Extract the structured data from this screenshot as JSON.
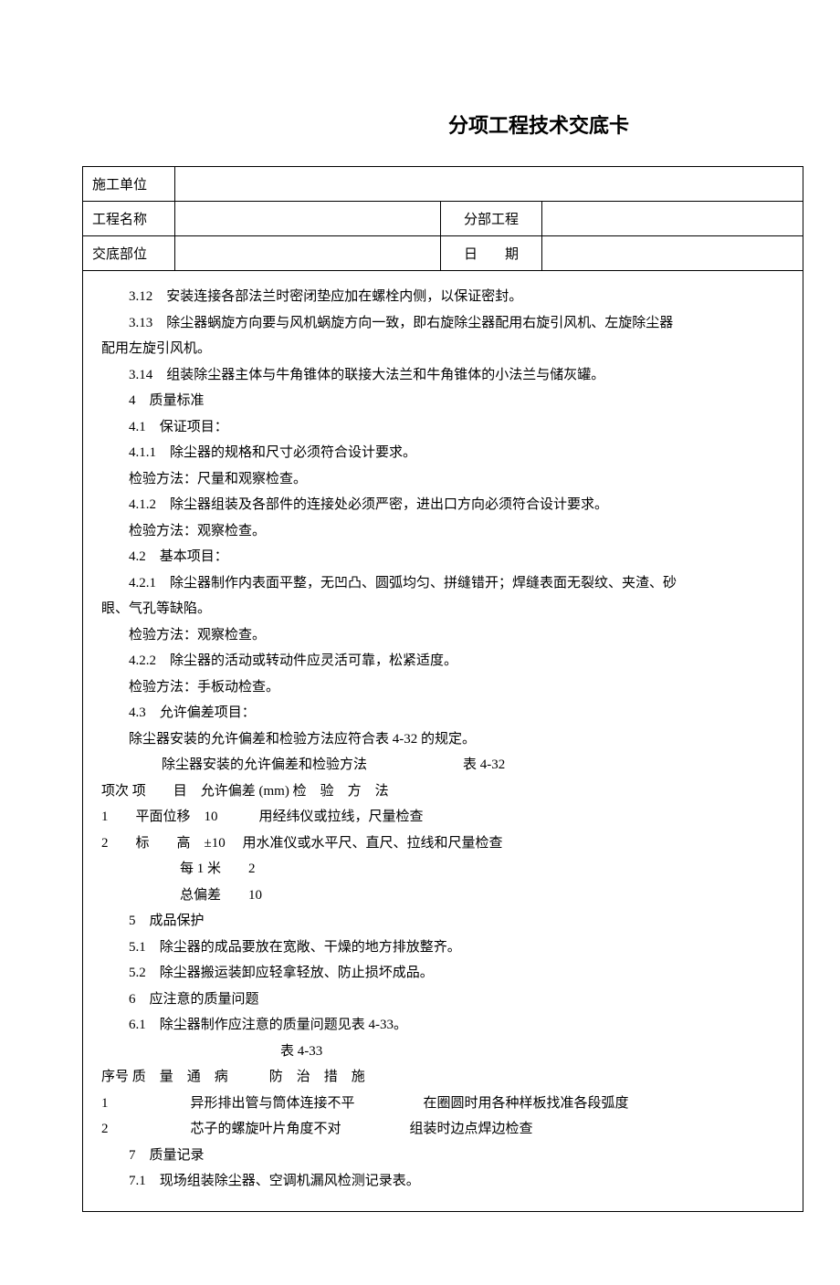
{
  "title": "分项工程技术交底卡",
  "header": {
    "l1": "施工单位",
    "l2": "工程名称",
    "l3": "交底部位",
    "s1": "分部工程",
    "s2": "日　　期",
    "v_unit": "",
    "v_project": "",
    "v_section": "",
    "v_sub": "",
    "v_date": ""
  },
  "content": {
    "p01": "3.12　安装连接各部法兰时密闭垫应加在螺栓内侧，以保证密封。",
    "p02": "3.13　除尘器蜗旋方向要与风机蜗旋方向一致，即右旋除尘器配用右旋引风机、左旋除尘器",
    "p02b": "配用左旋引风机。",
    "p03": "3.14　组装除尘器主体与牛角锥体的联接大法兰和牛角锥体的小法兰与储灰罐。",
    "p04": "4　质量标准",
    "p05": "4.1　保证项目：",
    "p06": "4.1.1　除尘器的规格和尺寸必须符合设计要求。",
    "p07": "检验方法：尺量和观察检查。",
    "p08": "4.1.2　除尘器组装及各部件的连接处必须严密，进出口方向必须符合设计要求。",
    "p09": "检验方法：观察检查。",
    "p10": "4.2　基本项目：",
    "p11": "4.2.1　除尘器制作内表面平整，无凹凸、圆弧均匀、拼缝错开；焊缝表面无裂纹、夹渣、砂",
    "p11b": "眼、气孔等缺陷。",
    "p12": "检验方法：观察检查。",
    "p13": "4.2.2　除尘器的活动或转动件应灵活可靠，松紧适度。",
    "p14": "检验方法：手板动检查。",
    "p15": "4.3　允许偏差项目：",
    "p16": "除尘器安装的允许偏差和检验方法应符合表 4-32 的规定。",
    "p17": "除尘器安装的允许偏差和检验方法　　　　　　　表 4-32",
    "p18": "项次 项　　目　允许偏差 (mm) 检　验　方　法",
    "p19": "1　　平面位移　10　　　用经纬仪或拉线，尺量检查",
    "p20": "2　　标　　高　±10　 用水准仪或水平尺、直尺、拉线和尺量检查",
    "p21": "每 1 米　　2",
    "p22": "总偏差　　10",
    "p23": "5　成品保护",
    "p24": "5.1　除尘器的成品要放在宽敞、干燥的地方排放整齐。",
    "p25": "5.2　除尘器搬运装卸应轻拿轻放、防止损坏成品。",
    "p26": "6　应注意的质量问题",
    "p27": "6.1　除尘器制作应注意的质量问题见表 4-33。",
    "p28": "表 4-33",
    "p29": "序号 质　量　通　病　　　防　治　措　施",
    "p30": "1　　　　　　异形排出管与筒体连接不平　　　　　在圈圆时用各种样板找准各段弧度",
    "p31": "2　　　　　　芯子的螺旋叶片角度不对　　　　　组装时边点焊边检查",
    "p32": "",
    "p33": "7　质量记录",
    "p34": "7.1　现场组装除尘器、空调机漏风检测记录表。"
  }
}
